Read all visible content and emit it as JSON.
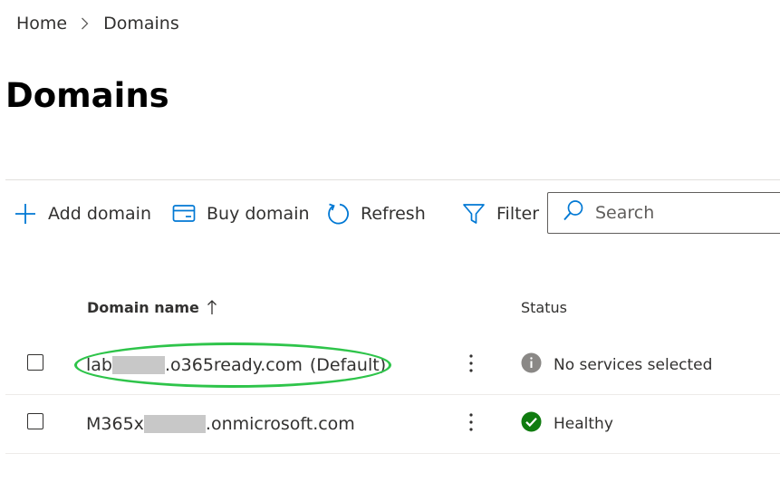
{
  "breadcrumb": {
    "home": "Home",
    "current": "Domains"
  },
  "page_title": "Domains",
  "toolbar": {
    "add_domain": "Add domain",
    "buy_domain": "Buy domain",
    "refresh": "Refresh",
    "filter": "Filter",
    "search_placeholder": "Search"
  },
  "table": {
    "columns": {
      "domain_name": "Domain name",
      "status": "Status"
    },
    "sort": "ascending",
    "rows": [
      {
        "domain_prefix": "lab",
        "domain_suffix": ".o365ready.com",
        "default_tag": "(Default)",
        "status": "No services selected",
        "status_icon": "info-icon",
        "selected": false
      },
      {
        "domain_prefix": "M365x",
        "domain_suffix": ".onmicrosoft.com",
        "default_tag": "",
        "status": "Healthy",
        "status_icon": "check-circle-icon",
        "selected": false
      }
    ]
  },
  "colors": {
    "accent": "#0078d4",
    "healthy": "#107c10",
    "info": "#8a8886",
    "annotation": "#2ec44a"
  }
}
